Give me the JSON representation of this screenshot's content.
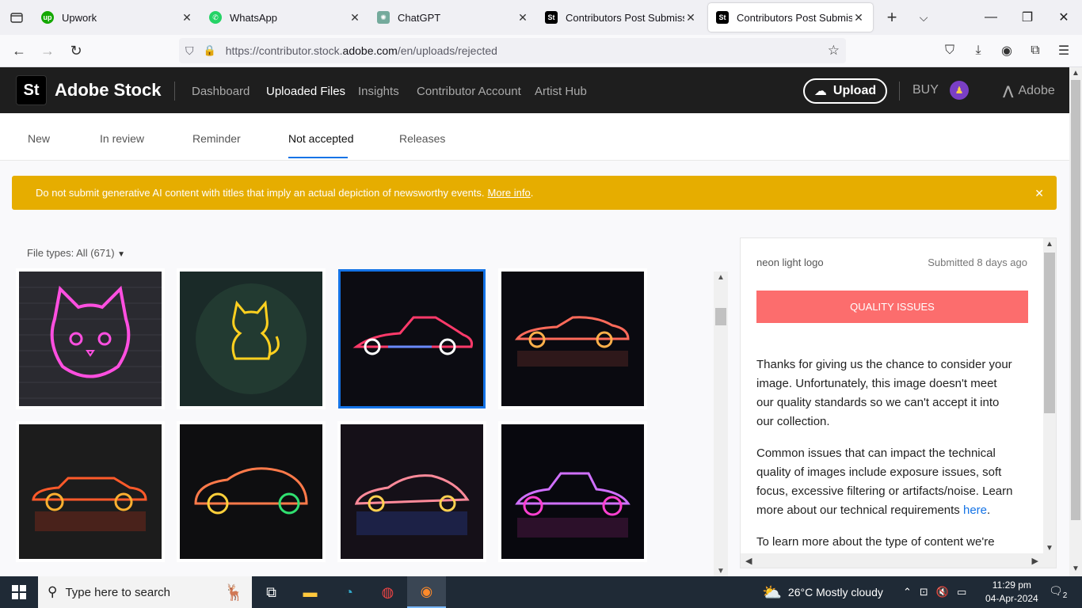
{
  "browser": {
    "tabs": [
      {
        "title": "Upwork",
        "favicon": "upwork-icon",
        "color": "#14a800",
        "active": false
      },
      {
        "title": "WhatsApp",
        "favicon": "whatsapp-icon",
        "color": "#25d366",
        "active": false
      },
      {
        "title": "ChatGPT",
        "favicon": "chatgpt-icon",
        "color": "#74aa9c",
        "active": false
      },
      {
        "title": "Contributors Post Submission",
        "favicon": "adobe-stock-icon",
        "color": "#000000",
        "active": false
      },
      {
        "title": "Contributors Post Submission",
        "favicon": "adobe-stock-icon",
        "color": "#000000",
        "active": true
      }
    ],
    "url_prefix": "https://contributor.stock.",
    "url_host": "adobe.com",
    "url_suffix": "/en/uploads/rejected"
  },
  "header": {
    "logo": "St",
    "brand": "Adobe Stock",
    "nav": [
      {
        "label": "Dashboard",
        "active": false
      },
      {
        "label": "Uploaded Files",
        "active": true
      },
      {
        "label": "Insights",
        "active": false
      },
      {
        "label": "Contributor Account",
        "active": false
      },
      {
        "label": "Artist Hub",
        "active": false
      }
    ],
    "upload_label": "Upload",
    "buy_label": "BUY",
    "adobe_label": "Adobe"
  },
  "subtabs": [
    {
      "label": "New",
      "active": false
    },
    {
      "label": "In review",
      "active": false
    },
    {
      "label": "Reminder",
      "active": false
    },
    {
      "label": "Not accepted",
      "active": true
    },
    {
      "label": "Releases",
      "active": false
    }
  ],
  "banner": {
    "text": "Do not submit generative AI content with titles that imply an actual depiction of newsworthy events.",
    "link": "More info",
    "suffix": ".",
    "bg_color": "#e6ad00"
  },
  "file_types": "File types: All (671)",
  "thumbnails": [
    {
      "subject": "neon cat face",
      "selected": false
    },
    {
      "subject": "neon sitting cat",
      "selected": false
    },
    {
      "subject": "neon vintage car",
      "selected": true
    },
    {
      "subject": "neon sports car",
      "selected": false
    },
    {
      "subject": "neon classic car",
      "selected": false
    },
    {
      "subject": "neon compact car",
      "selected": false
    },
    {
      "subject": "neon coupe",
      "selected": false
    },
    {
      "subject": "neon vintage roadster",
      "selected": false
    }
  ],
  "detail": {
    "title": "neon light logo",
    "submitted": "Submitted 8 days ago",
    "status": "QUALITY ISSUES",
    "status_color": "#fc6d6d",
    "para1": "Thanks for giving us the chance to consider your image. Unfortunately, this image doesn't meet our quality standards so we can't accept it into our collection.",
    "para2_text": "Common issues that can impact the technical quality of images include exposure issues, soft focus, excessive filtering or artifacts/noise. Learn more about our technical requirements",
    "para2_link": "here",
    "para2_end": ".",
    "para3": "To learn more about the type of content we're"
  },
  "taskbar": {
    "search_placeholder": "Type here to search",
    "weather": "26°C  Mostly cloudy",
    "time": "11:29 pm",
    "date": "04-Apr-2024",
    "notifications": "2"
  }
}
